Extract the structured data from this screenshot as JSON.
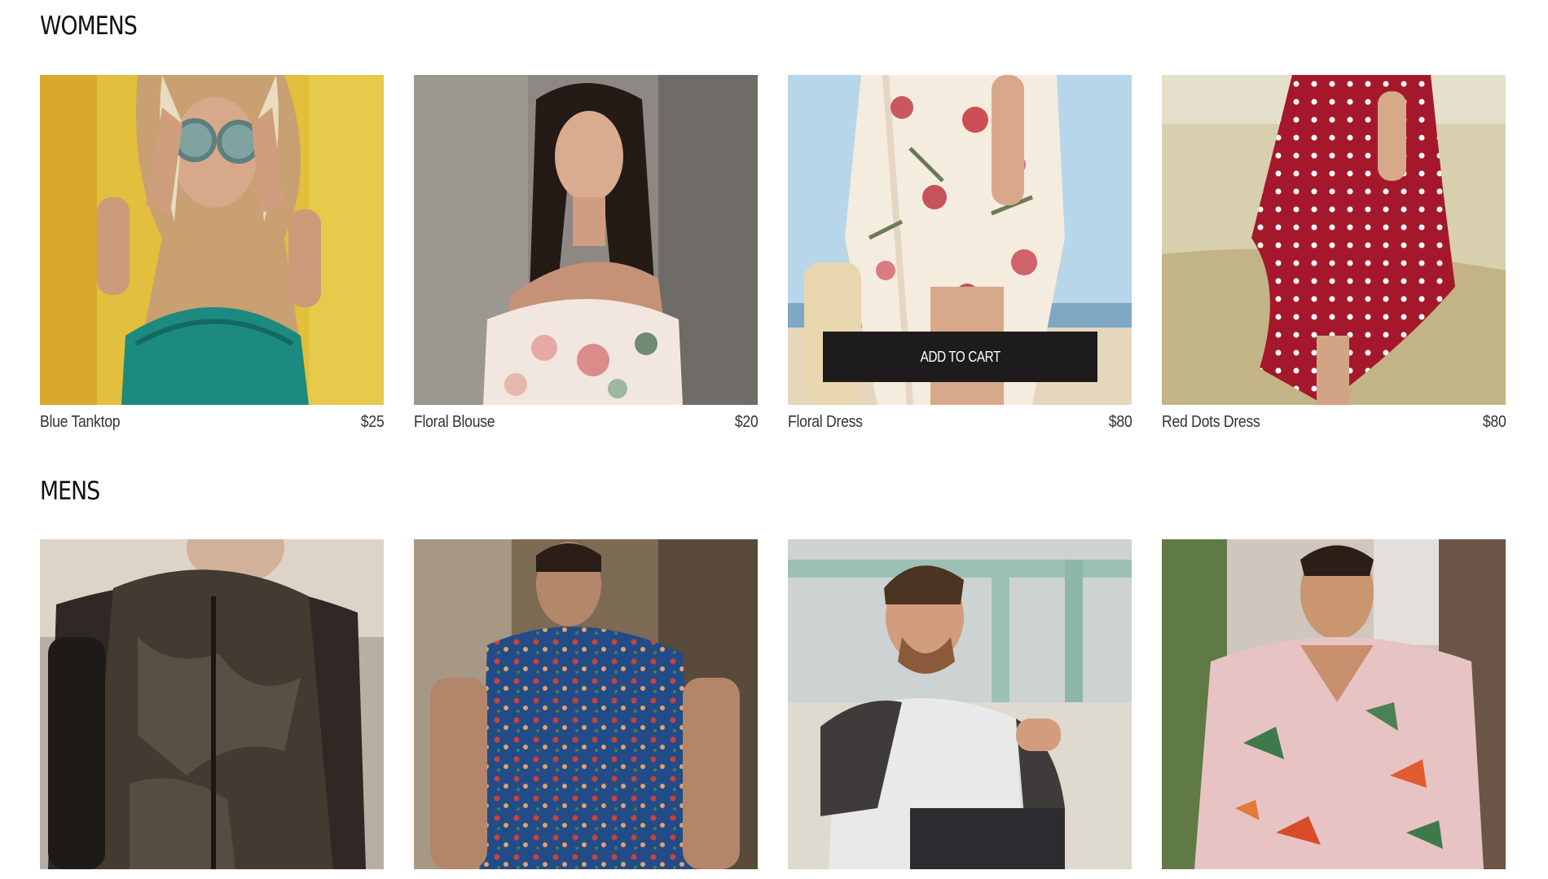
{
  "sections": {
    "womens": {
      "title": "WOMENS",
      "products": [
        {
          "name": "Blue Tanktop",
          "price": "$25",
          "image": "woman-yellow-wall-sunglasses"
        },
        {
          "name": "Floral Blouse",
          "price": "$20",
          "image": "woman-off-shoulder-floral-blouse"
        },
        {
          "name": "Floral Dress",
          "price": "$80",
          "image": "woman-white-floral-dress"
        },
        {
          "name": "Red Dots Dress",
          "price": "$80",
          "image": "woman-red-polka-dot-dress"
        }
      ]
    },
    "mens": {
      "title": "MENS",
      "products": [
        {
          "image": "man-camo-puffer-vest"
        },
        {
          "image": "man-blue-floral-shirt"
        },
        {
          "image": "man-raglan-tee-smiling"
        },
        {
          "image": "man-pink-hawaiian-shirt"
        }
      ]
    }
  },
  "hover_overlay": {
    "add_to_cart_label": "ADD TO CART"
  },
  "colors": {
    "background": "#ffffff",
    "text": "#1a1a1a",
    "button_bg": "#1d1b1b",
    "button_text": "#ffffff"
  }
}
